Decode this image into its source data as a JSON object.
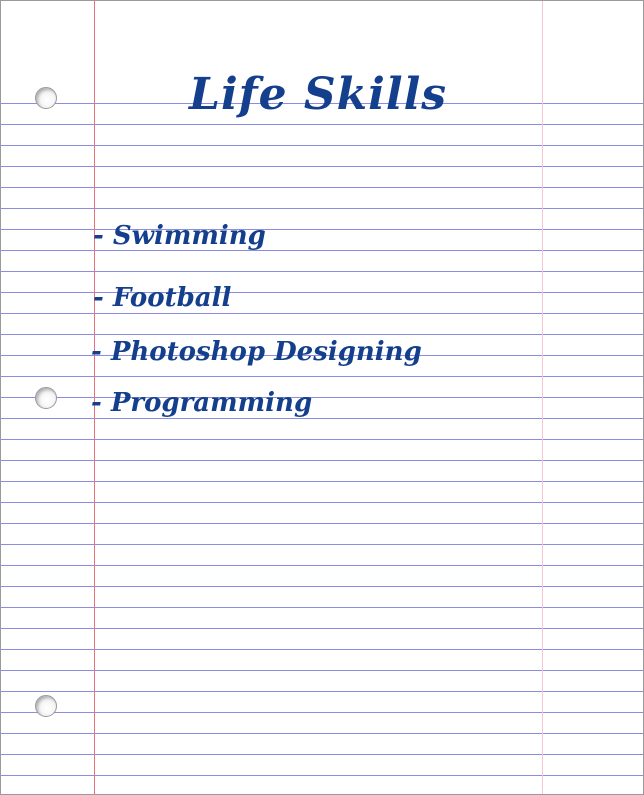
{
  "title": "Life Skills",
  "skills": [
    "- Swimming",
    "- Football",
    "- Photoshop Designing",
    "- Programming"
  ],
  "colors": {
    "ink": "#143f8c",
    "rule_lines": "#8c8ce0",
    "margin_line": "#e8707f",
    "right_margin": "#f4c6d6",
    "paper": "#ffffff"
  },
  "icons": [
    "binder-hole-icon",
    "binder-hole-icon",
    "binder-hole-icon"
  ]
}
